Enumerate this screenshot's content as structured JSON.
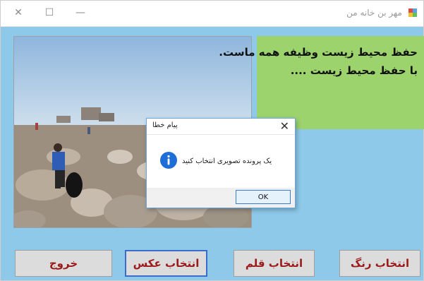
{
  "window": {
    "title": "مهر بن خانه من",
    "controls": {
      "close": "✕",
      "maximize": "☐",
      "minimize": "—"
    }
  },
  "panel": {
    "line1": "حفظ محیط زیست وظیفه همه ماست.",
    "line2": "با حفظ محیط زیست ...."
  },
  "buttons": {
    "exit": "خروج",
    "choose_image": "انتخاب عکس",
    "choose_pen": "انتخاب قلم",
    "choose_color": "انتخاب رنگ"
  },
  "dialog": {
    "title": "پیام خطا",
    "close": "✕",
    "message": "یک پرونده تصویری انتخاب کنید",
    "ok": "OK"
  },
  "colors": {
    "window_bg": "#8ec9ea",
    "green_panel": "#9cd36d",
    "button_text": "#9b1a1a",
    "info_icon": "#1d6ed6"
  }
}
